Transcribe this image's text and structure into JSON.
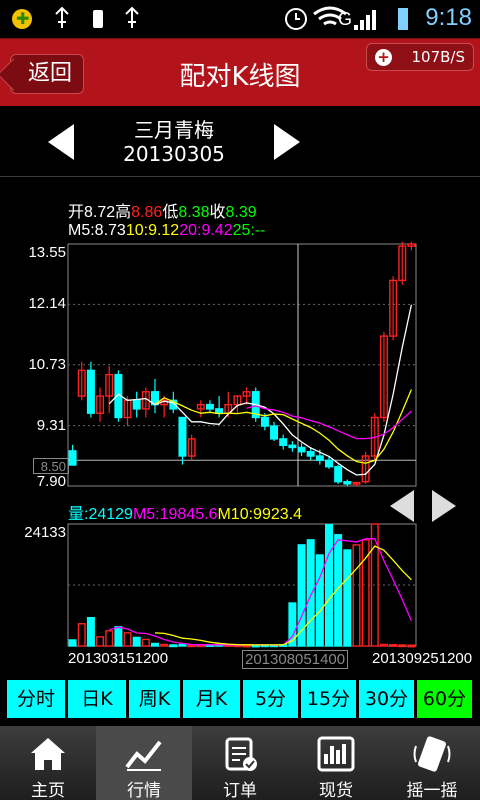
{
  "status_bar": {
    "time": "9:18",
    "network": "G"
  },
  "header": {
    "back_label": "返回",
    "title": "配对K线图",
    "net_rate": "107B/S"
  },
  "stock": {
    "name": "三月青梅",
    "date": "20130305"
  },
  "ohlc": {
    "open_label": "开",
    "open": "8.72",
    "high_label": "高",
    "high": "8.86",
    "low_label": "低",
    "low": "8.38",
    "close_label": "收",
    "close": "8.39"
  },
  "ma": {
    "m5_label": "M5:",
    "m5": "8.73",
    "m10_label": "10:",
    "m10": "9.12",
    "m20_label": "20:",
    "m20": "9.42",
    "m25_label": "25:",
    "m25": "--"
  },
  "price_axis": {
    "ticks": [
      "13.55",
      "12.14",
      "10.73",
      "9.31",
      "7.90"
    ],
    "cursor_price": "8.50"
  },
  "volume": {
    "label": "量:",
    "value": "24129",
    "m5_label": "M5:",
    "m5": "19845.6",
    "m10_label": "M10:",
    "m10": "9923.4",
    "max_tick": "24133"
  },
  "x_axis": {
    "left_date": "201303151200",
    "cursor_date": "201308051400",
    "right_date": "201309251200"
  },
  "periods": [
    "分时",
    "日K",
    "周K",
    "月K",
    "5分",
    "15分",
    "30分",
    "60分"
  ],
  "active_period": "60分",
  "tabs": [
    {
      "label": "主页",
      "icon": "home-icon"
    },
    {
      "label": "行情",
      "icon": "trend-chart-icon"
    },
    {
      "label": "订单",
      "icon": "order-clipboard-icon"
    },
    {
      "label": "现货",
      "icon": "bar-chart-icon"
    },
    {
      "label": "摇一摇",
      "icon": "shake-phone-icon"
    }
  ],
  "active_tab": "行情",
  "colors": {
    "up": "#ff2020",
    "down": "#00ffff",
    "m5": "#ffffff",
    "m10": "#ffff00",
    "m20": "#ff00ff",
    "m25": "#00ff00",
    "accent": "#b3131a"
  },
  "chart_data": {
    "type": "candlestick",
    "price_ylim": [
      7.9,
      13.55
    ],
    "candles": [
      [
        8.72,
        8.86,
        8.38,
        8.39
      ],
      [
        10.0,
        10.8,
        9.9,
        10.6
      ],
      [
        10.6,
        10.8,
        9.5,
        9.6
      ],
      [
        9.6,
        10.2,
        9.4,
        10.0
      ],
      [
        10.0,
        10.7,
        9.6,
        10.5
      ],
      [
        10.5,
        10.6,
        9.4,
        9.5
      ],
      [
        9.5,
        10.0,
        9.3,
        9.9
      ],
      [
        9.9,
        10.1,
        9.5,
        9.7
      ],
      [
        9.7,
        10.2,
        9.5,
        10.1
      ],
      [
        10.1,
        10.4,
        9.6,
        9.8
      ],
      [
        9.8,
        10.0,
        9.5,
        9.9
      ],
      [
        9.9,
        10.1,
        9.6,
        9.7
      ],
      [
        9.5,
        9.5,
        8.4,
        8.6
      ],
      [
        8.6,
        9.1,
        8.5,
        9.0
      ],
      [
        9.7,
        9.9,
        9.5,
        9.8
      ],
      [
        9.8,
        9.9,
        9.6,
        9.7
      ],
      [
        9.7,
        10.0,
        9.5,
        9.6
      ],
      [
        9.6,
        10.1,
        9.5,
        9.8
      ],
      [
        9.8,
        10.0,
        9.6,
        10.0
      ],
      [
        10.0,
        10.2,
        9.8,
        10.1
      ],
      [
        10.1,
        10.2,
        9.4,
        9.5
      ],
      [
        9.5,
        9.6,
        9.2,
        9.3
      ],
      [
        9.3,
        9.4,
        8.95,
        9.0
      ],
      [
        9.0,
        9.1,
        8.75,
        8.85
      ],
      [
        8.85,
        8.95,
        8.7,
        8.8
      ],
      [
        8.8,
        8.9,
        8.6,
        8.7
      ],
      [
        8.7,
        8.8,
        8.5,
        8.6
      ],
      [
        8.6,
        8.75,
        8.4,
        8.5
      ],
      [
        8.5,
        8.6,
        8.3,
        8.35
      ],
      [
        8.35,
        8.4,
        7.95,
        8.0
      ],
      [
        8.0,
        8.05,
        7.9,
        7.95
      ],
      [
        7.95,
        8.0,
        7.9,
        7.98
      ],
      [
        8.0,
        8.7,
        7.95,
        8.6
      ],
      [
        8.6,
        9.6,
        8.5,
        9.5
      ],
      [
        9.5,
        11.5,
        9.4,
        11.4
      ],
      [
        11.4,
        12.8,
        11.3,
        12.7
      ],
      [
        12.7,
        13.6,
        12.6,
        13.5
      ],
      [
        13.5,
        13.6,
        13.4,
        13.55
      ]
    ],
    "volume_ylim": [
      0,
      24133
    ],
    "volume": [
      1200,
      4400,
      5600,
      1800,
      3000,
      3800,
      2600,
      1700,
      1300,
      500,
      300,
      200,
      300,
      200,
      200,
      250,
      300,
      250,
      200,
      150,
      150,
      200,
      200,
      250,
      8500,
      20000,
      21000,
      18000,
      24000,
      22000,
      19000,
      20000,
      21000,
      24129,
      300,
      250,
      200,
      150
    ]
  }
}
